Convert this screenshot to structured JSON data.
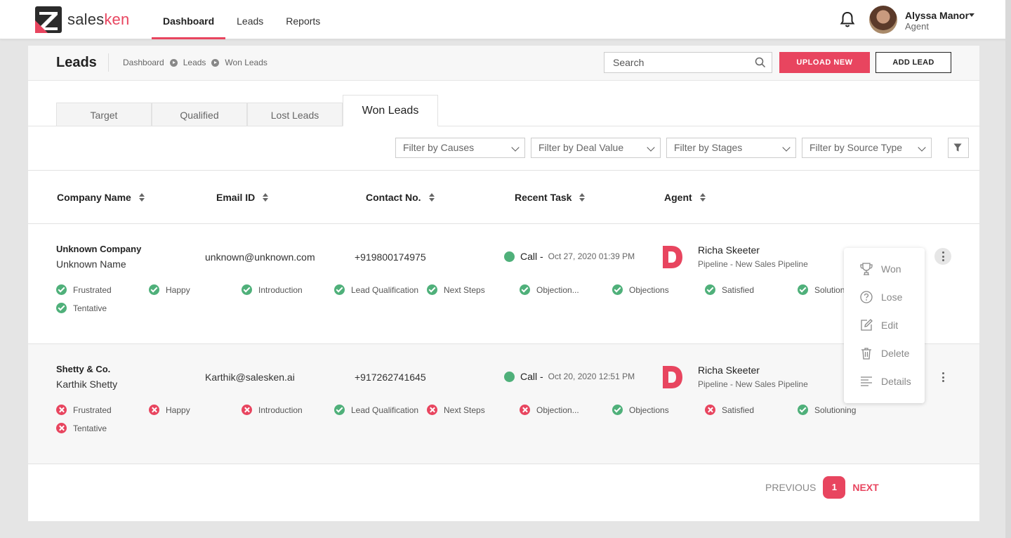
{
  "brand": {
    "name_prefix": "sales",
    "name_suffix": "ken",
    "accent": "#e8455f",
    "success": "#4fb07a"
  },
  "nav": {
    "items": [
      {
        "label": "Dashboard",
        "active": true
      },
      {
        "label": "Leads"
      },
      {
        "label": "Reports"
      }
    ]
  },
  "user": {
    "name": "Alyssa Manor",
    "role": "Agent"
  },
  "page": {
    "title": "Leads",
    "breadcrumb": [
      "Dashboard",
      "Leads",
      "Won Leads"
    ]
  },
  "search": {
    "placeholder": "Search"
  },
  "actions": {
    "upload": "UPLOAD NEW",
    "add": "ADD LEAD"
  },
  "tabs": [
    "Target",
    "Qualified",
    "Lost Leads",
    "Won Leads"
  ],
  "active_tab": "Won Leads",
  "filters": [
    "Filter by Causes",
    "Filter by Deal Value",
    "Filter by Stages",
    "Filter by Source Type"
  ],
  "columns": [
    "Company Name",
    "Email ID",
    "Contact No.",
    "Recent Task",
    "Agent"
  ],
  "rows": [
    {
      "company": "Unknown Company",
      "contact": "Unknown Name",
      "email": "unknown@unknown.com",
      "phone": "+919800174975",
      "task_type": "Call -",
      "task_date": "Oct 27, 2020 01:39 PM",
      "agent": "Richa Skeeter",
      "pipeline": "Pipeline - New Sales Pipeline",
      "tags": [
        {
          "label": "Frustrated",
          "ok": true
        },
        {
          "label": "Happy",
          "ok": true
        },
        {
          "label": "Introduction",
          "ok": true
        },
        {
          "label": "Lead Qualification",
          "ok": true
        },
        {
          "label": "Next Steps",
          "ok": true
        },
        {
          "label": "Objection...",
          "ok": true
        },
        {
          "label": "Objections",
          "ok": true
        },
        {
          "label": "Satisfied",
          "ok": true
        },
        {
          "label": "Solutioning",
          "ok": true
        },
        {
          "label": "Tentative",
          "ok": true
        }
      ]
    },
    {
      "company": "Shetty & Co.",
      "contact": "Karthik Shetty",
      "email": "Karthik@salesken.ai",
      "phone": "+917262741645",
      "task_type": "Call -",
      "task_date": "Oct 20, 2020 12:51 PM",
      "agent": "Richa Skeeter",
      "pipeline": "Pipeline - New Sales Pipeline",
      "tags": [
        {
          "label": "Frustrated",
          "ok": false
        },
        {
          "label": "Happy",
          "ok": false
        },
        {
          "label": "Introduction",
          "ok": false
        },
        {
          "label": "Lead Qualification",
          "ok": true
        },
        {
          "label": "Next Steps",
          "ok": false
        },
        {
          "label": "Objection...",
          "ok": false
        },
        {
          "label": "Objections",
          "ok": true
        },
        {
          "label": "Satisfied",
          "ok": false
        },
        {
          "label": "Solutioning",
          "ok": true
        },
        {
          "label": "Tentative",
          "ok": false
        }
      ]
    }
  ],
  "row_menu": [
    {
      "label": "Won",
      "icon": "trophy-icon"
    },
    {
      "label": "Lose",
      "icon": "question-circle-icon"
    },
    {
      "label": "Edit",
      "icon": "edit-icon"
    },
    {
      "label": "Delete",
      "icon": "trash-icon"
    },
    {
      "label": "Details",
      "icon": "details-lines-icon"
    }
  ],
  "pagination": {
    "previous": "PREVIOUS",
    "current": "1",
    "next": "NEXT"
  }
}
